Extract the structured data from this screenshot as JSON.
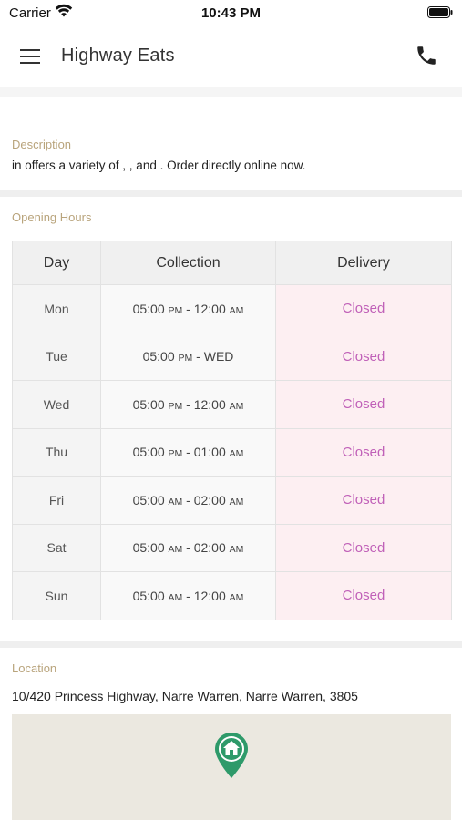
{
  "status_bar": {
    "carrier": "Carrier",
    "time": "10:43 PM"
  },
  "header": {
    "title": "Highway Eats"
  },
  "description": {
    "label": "Description",
    "text": "in  offers a variety of , ,  and  . Order directly online now."
  },
  "hours": {
    "label": "Opening Hours",
    "columns": [
      "Day",
      "Collection",
      "Delivery"
    ],
    "rows": [
      {
        "day": "Mon",
        "start": "05:00",
        "start_ampm": "PM",
        "end": "12:00",
        "end_ampm": "AM",
        "delivery": "Closed"
      },
      {
        "day": "Tue",
        "start": "05:00",
        "start_ampm": "PM",
        "end": "WED",
        "end_ampm": "",
        "delivery": "Closed"
      },
      {
        "day": "Wed",
        "start": "05:00",
        "start_ampm": "PM",
        "end": "12:00",
        "end_ampm": "AM",
        "delivery": "Closed"
      },
      {
        "day": "Thu",
        "start": "05:00",
        "start_ampm": "PM",
        "end": "01:00",
        "end_ampm": "AM",
        "delivery": "Closed"
      },
      {
        "day": "Fri",
        "start": "05:00",
        "start_ampm": "AM",
        "end": "02:00",
        "end_ampm": "AM",
        "delivery": "Closed"
      },
      {
        "day": "Sat",
        "start": "05:00",
        "start_ampm": "AM",
        "end": "02:00",
        "end_ampm": "AM",
        "delivery": "Closed"
      },
      {
        "day": "Sun",
        "start": "05:00",
        "start_ampm": "AM",
        "end": "12:00",
        "end_ampm": "AM",
        "delivery": "Closed"
      }
    ]
  },
  "location": {
    "label": "Location",
    "address": "10/420 Princess Highway, Narre Warren, Narre Warren, 3805"
  },
  "colors": {
    "label": "#b9a47c",
    "closed_text": "#c060b8",
    "closed_bg": "#fdeff2",
    "pin": "#2e9a6a",
    "map_bg": "#ebe8e0"
  },
  "icons": [
    "wifi-icon",
    "battery-icon",
    "menu-icon",
    "phone-icon",
    "map-pin-icon",
    "home-icon"
  ]
}
